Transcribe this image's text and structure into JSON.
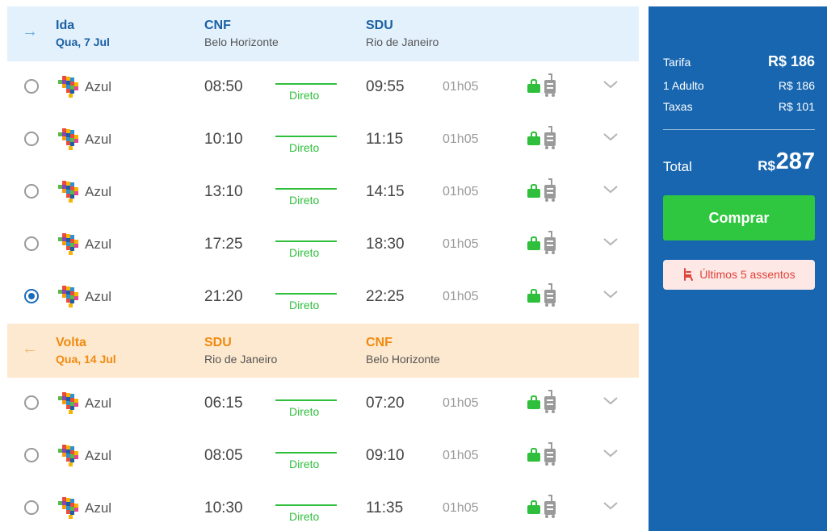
{
  "outbound": {
    "direction": "Ida",
    "date": "Qua, 7 Jul",
    "origin_code": "CNF",
    "origin_city": "Belo Horizonte",
    "dest_code": "SDU",
    "dest_city": "Rio de Janeiro",
    "flights": [
      {
        "airline": "Azul",
        "dep": "08:50",
        "arr": "09:55",
        "stops": "Direto",
        "duration": "01h05",
        "selected": false
      },
      {
        "airline": "Azul",
        "dep": "10:10",
        "arr": "11:15",
        "stops": "Direto",
        "duration": "01h05",
        "selected": false
      },
      {
        "airline": "Azul",
        "dep": "13:10",
        "arr": "14:15",
        "stops": "Direto",
        "duration": "01h05",
        "selected": false
      },
      {
        "airline": "Azul",
        "dep": "17:25",
        "arr": "18:30",
        "stops": "Direto",
        "duration": "01h05",
        "selected": false
      },
      {
        "airline": "Azul",
        "dep": "21:20",
        "arr": "22:25",
        "stops": "Direto",
        "duration": "01h05",
        "selected": true
      }
    ]
  },
  "inbound": {
    "direction": "Volta",
    "date": "Qua, 14 Jul",
    "origin_code": "SDU",
    "origin_city": "Rio de Janeiro",
    "dest_code": "CNF",
    "dest_city": "Belo Horizonte",
    "flights": [
      {
        "airline": "Azul",
        "dep": "06:15",
        "arr": "07:20",
        "stops": "Direto",
        "duration": "01h05",
        "selected": false
      },
      {
        "airline": "Azul",
        "dep": "08:05",
        "arr": "09:10",
        "stops": "Direto",
        "duration": "01h05",
        "selected": false
      },
      {
        "airline": "Azul",
        "dep": "10:30",
        "arr": "11:35",
        "stops": "Direto",
        "duration": "01h05",
        "selected": false
      }
    ]
  },
  "summary": {
    "tarifa_label": "Tarifa",
    "tarifa_value": "R$ 186",
    "adulto_label": "1 Adulto",
    "adulto_value": "R$ 186",
    "taxas_label": "Taxas",
    "taxas_value": "R$ 101",
    "total_label": "Total",
    "total_currency": "R$",
    "total_value": "287",
    "buy_button": "Comprar",
    "alert_text": "Últimos 5 assentos"
  },
  "colors": {
    "panel_bg": "#1866b0",
    "green": "#2fbf3c",
    "outbound_header_bg": "#e3f1fd",
    "inbound_header_bg": "#fde9cf",
    "alert_red": "#e0433a"
  },
  "icons": {
    "outbound_arrow": "arrow-right-icon",
    "inbound_arrow": "arrow-left-icon",
    "airline_logo": "azul-logo",
    "carry_on": "carry-on-bag-icon",
    "checked_bag": "checked-luggage-icon",
    "expand": "chevron-down-icon",
    "seat": "seat-icon"
  }
}
